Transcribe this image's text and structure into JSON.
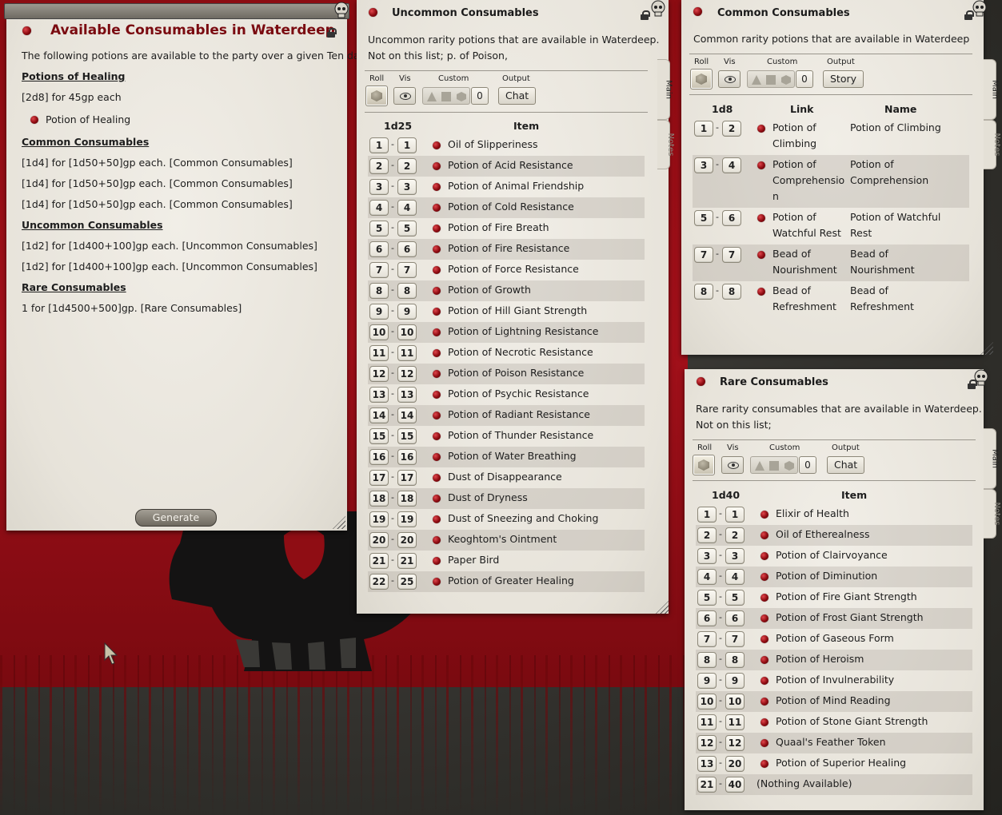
{
  "colors": {
    "accent_dot": "#8b0a10",
    "title_red": "#7a0a10",
    "panel": "#ece9e1"
  },
  "main_window": {
    "title": "Available Consumables in Waterdeep",
    "intro": "The following potions are available to the party over a given Ten day.",
    "sections": [
      {
        "heading": "Potions of Healing",
        "lines": [
          "[2d8] for 45gp each"
        ],
        "link": "Potion of Healing"
      },
      {
        "heading": "Common Consumables",
        "lines": [
          "[1d4] for [1d50+50]gp each. [Common Consumables]",
          "[1d4] for [1d50+50]gp each. [Common Consumables]",
          "[1d4] for [1d50+50]gp each. [Common Consumables]"
        ]
      },
      {
        "heading": "Uncommon Consumables",
        "lines": [
          "[1d2] for [1d400+100]gp each. [Uncommon Consumables]",
          "[1d2] for [1d400+100]gp each. [Uncommon Consumables]"
        ]
      },
      {
        "heading": "Rare Consumables",
        "lines": [
          "1 for [1d4500+500]gp. [Rare Consumables]"
        ]
      }
    ],
    "generate_label": "Generate"
  },
  "controls": {
    "roll": "Roll",
    "vis": "Vis",
    "custom": "Custom",
    "output": "Output",
    "custom_value": "0"
  },
  "tabs": {
    "main": "Main",
    "notes": "Notes"
  },
  "uncommon": {
    "title": "Uncommon Consumables",
    "desc": [
      "Uncommon rarity potions that are available in Waterdeep.",
      "Not on this list; p. of Poison,"
    ],
    "output": "Chat",
    "dice": "1d25",
    "col_item": "Item",
    "rows": [
      [
        "1",
        "1",
        "Oil of Slipperiness"
      ],
      [
        "2",
        "2",
        "Potion of Acid Resistance"
      ],
      [
        "3",
        "3",
        "Potion of Animal Friendship"
      ],
      [
        "4",
        "4",
        "Potion of Cold Resistance"
      ],
      [
        "5",
        "5",
        "Potion of Fire Breath"
      ],
      [
        "6",
        "6",
        "Potion of Fire Resistance"
      ],
      [
        "7",
        "7",
        "Potion of Force Resistance"
      ],
      [
        "8",
        "8",
        "Potion of Growth"
      ],
      [
        "9",
        "9",
        "Potion of Hill Giant Strength"
      ],
      [
        "10",
        "10",
        "Potion of Lightning Resistance"
      ],
      [
        "11",
        "11",
        "Potion of Necrotic Resistance"
      ],
      [
        "12",
        "12",
        "Potion of Poison Resistance"
      ],
      [
        "13",
        "13",
        "Potion of Psychic Resistance"
      ],
      [
        "14",
        "14",
        "Potion of Radiant Resistance"
      ],
      [
        "15",
        "15",
        "Potion of Thunder Resistance"
      ],
      [
        "16",
        "16",
        "Potion of Water Breathing"
      ],
      [
        "17",
        "17",
        "Dust of Disappearance"
      ],
      [
        "18",
        "18",
        "Dust of Dryness"
      ],
      [
        "19",
        "19",
        "Dust of Sneezing and Choking"
      ],
      [
        "20",
        "20",
        "Keoghtom's Ointment"
      ],
      [
        "21",
        "21",
        "Paper Bird"
      ],
      [
        "22",
        "25",
        "Potion of Greater Healing"
      ]
    ]
  },
  "common": {
    "title": "Common Consumables",
    "desc": [
      "Common rarity potions that are available in Waterdeep"
    ],
    "output": "Story",
    "dice": "1d8",
    "col_link": "Link",
    "col_name": "Name",
    "rows": [
      {
        "from": "1",
        "to": "2",
        "link": [
          "Potion of",
          "Climbing"
        ],
        "name": [
          "Potion of Climbing"
        ]
      },
      {
        "from": "3",
        "to": "4",
        "link": [
          "Potion of",
          "Comprehensio",
          "n"
        ],
        "name": [
          "Potion of",
          "Comprehension"
        ]
      },
      {
        "from": "5",
        "to": "6",
        "link": [
          "Potion of",
          "Watchful Rest"
        ],
        "name": [
          "Potion of Watchful",
          "Rest"
        ]
      },
      {
        "from": "7",
        "to": "7",
        "link": [
          "Bead of",
          "Nourishment"
        ],
        "name": [
          "Bead of",
          "Nourishment"
        ]
      },
      {
        "from": "8",
        "to": "8",
        "link": [
          "Bead of",
          "Refreshment"
        ],
        "name": [
          "Bead of",
          "Refreshment"
        ]
      }
    ]
  },
  "rare": {
    "title": "Rare Consumables",
    "desc": [
      "Rare rarity consumables that are available in Waterdeep.",
      "Not on this list;"
    ],
    "output": "Chat",
    "dice": "1d40",
    "col_item": "Item",
    "rows": [
      [
        "1",
        "1",
        "Elixir of Health"
      ],
      [
        "2",
        "2",
        "Oil of Etherealness"
      ],
      [
        "3",
        "3",
        "Potion of Clairvoyance"
      ],
      [
        "4",
        "4",
        "Potion of Diminution"
      ],
      [
        "5",
        "5",
        "Potion of Fire Giant Strength"
      ],
      [
        "6",
        "6",
        "Potion of Frost Giant Strength"
      ],
      [
        "7",
        "7",
        "Potion of Gaseous Form"
      ],
      [
        "8",
        "8",
        "Potion of Heroism"
      ],
      [
        "9",
        "9",
        "Potion of Invulnerability"
      ],
      [
        "10",
        "10",
        "Potion of Mind Reading"
      ],
      [
        "11",
        "11",
        "Potion of Stone Giant Strength"
      ],
      [
        "12",
        "12",
        "Quaal's Feather Token"
      ],
      [
        "13",
        "20",
        "Potion of Superior Healing"
      ],
      [
        "21",
        "40",
        "(Nothing Available)"
      ]
    ]
  }
}
